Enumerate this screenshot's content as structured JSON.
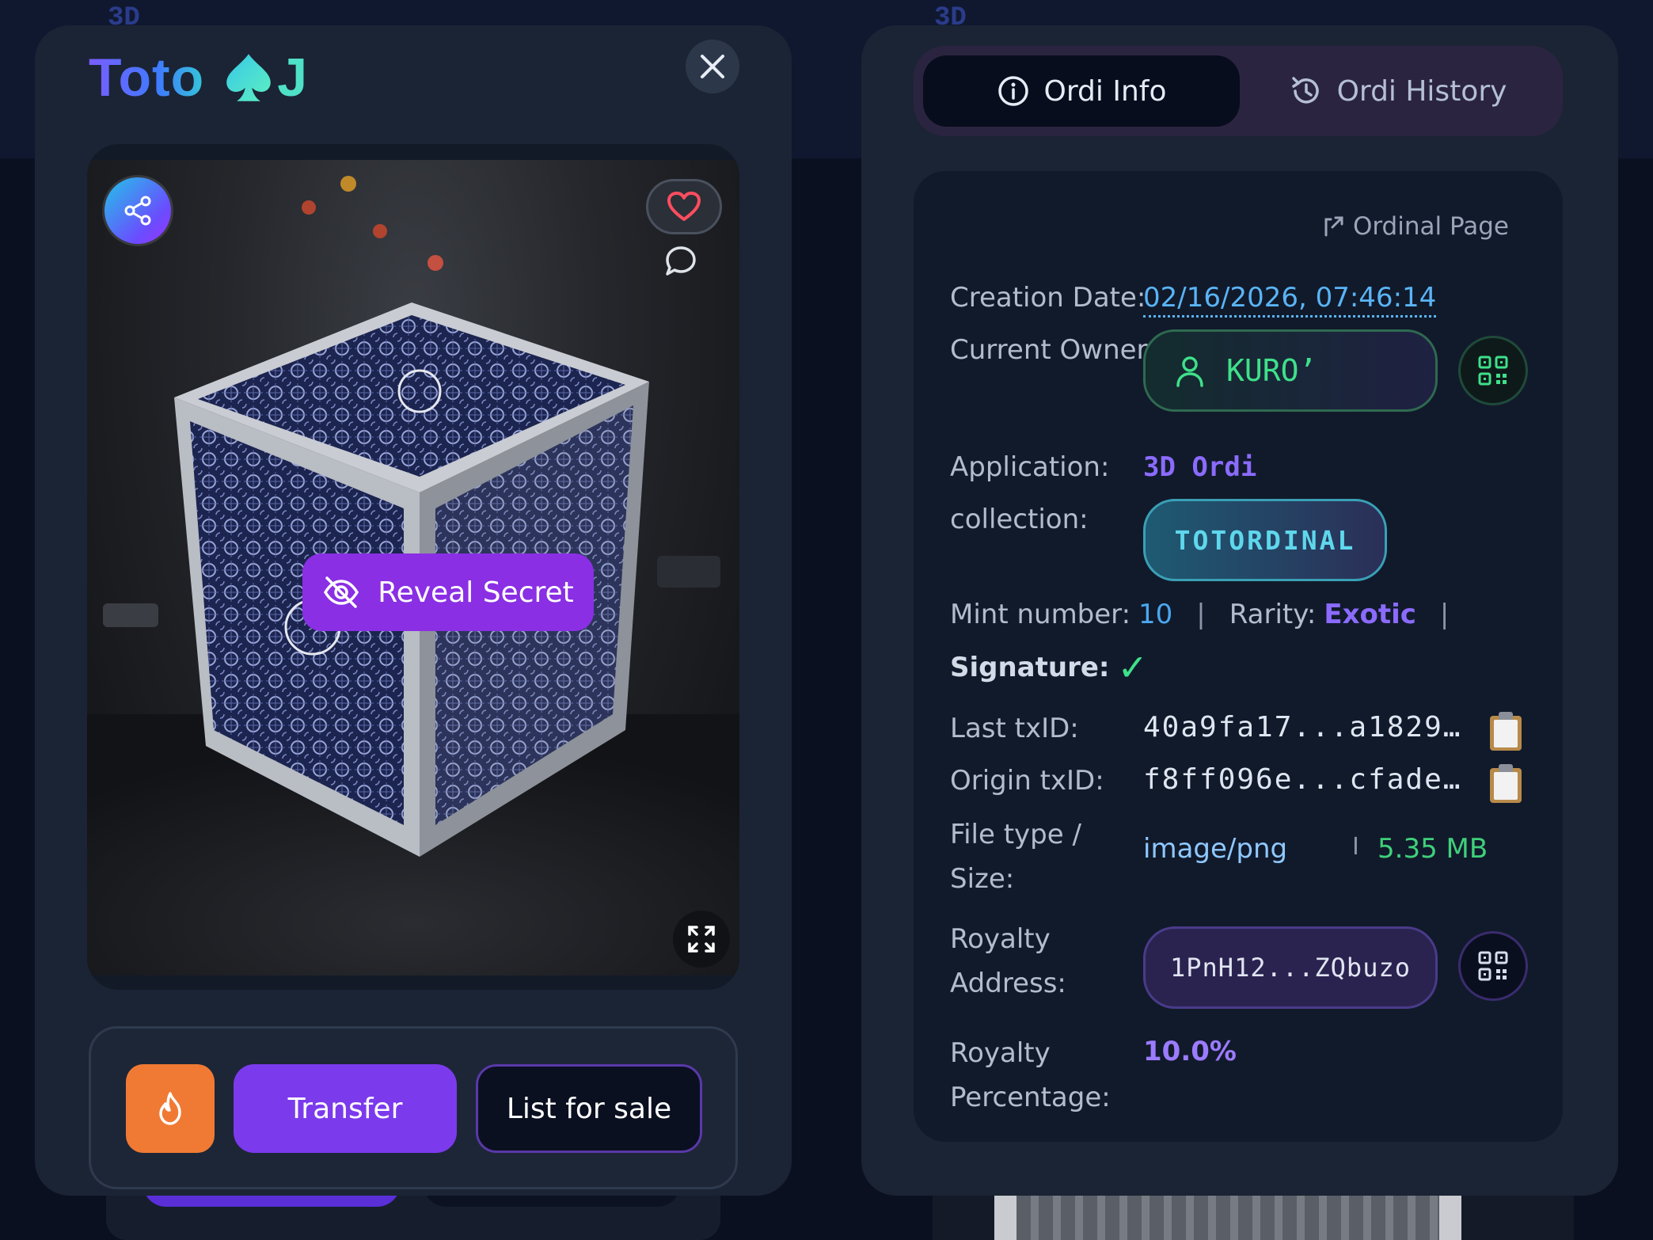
{
  "background": {
    "left_label": "3D",
    "right_label": "3D"
  },
  "left": {
    "logo": {
      "text": "Toto",
      "suffix": "J"
    },
    "image": {
      "reveal_label": "Reveal Secret"
    },
    "actions": {
      "transfer_label": "Transfer",
      "sale_label": "List for sale"
    }
  },
  "right": {
    "tabs": [
      {
        "label": "Ordi Info",
        "active": true
      },
      {
        "label": "Ordi History",
        "active": false
      }
    ],
    "ordinal_link": "Ordinal Page",
    "fields": {
      "creation_date_label": "Creation Date:",
      "creation_date": "02/16/2026, 07:46:14",
      "owner_label": "Current Owner:",
      "owner": "KURO’",
      "application_label": "Application:",
      "application": "3D Ordi",
      "collection_label": "collection:",
      "collection": "TOTORDINAL",
      "mint_label": "Mint number:",
      "mint_number": "10",
      "rarity_label": "Rarity:",
      "rarity": "Exotic",
      "signature_label": "Signature:",
      "signature_mark": "✓",
      "last_txid_label": "Last txID:",
      "last_txid": "40a9fa17...a1829…",
      "origin_txid_label": "Origin txID:",
      "origin_txid": "f8ff096e...cfade…",
      "file_label_1": "File type /",
      "file_label_2": "Size:",
      "file_type": "image/png",
      "file_sep": "I",
      "file_size": "5.35 MB",
      "royalty_addr_label_1": "Royalty",
      "royalty_addr_label_2": "Address:",
      "royalty_address": "1PnH12...ZQbuzo",
      "royalty_pct_label_1": "Royalty",
      "royalty_pct_label_2": "Percentage:",
      "royalty_pct": "10.0%"
    }
  },
  "colors": {
    "accent_purple": "#7c3aed",
    "owner_green": "#3fe08a",
    "link_blue": "#5ab4f5",
    "burn_orange": "#f07a34"
  }
}
